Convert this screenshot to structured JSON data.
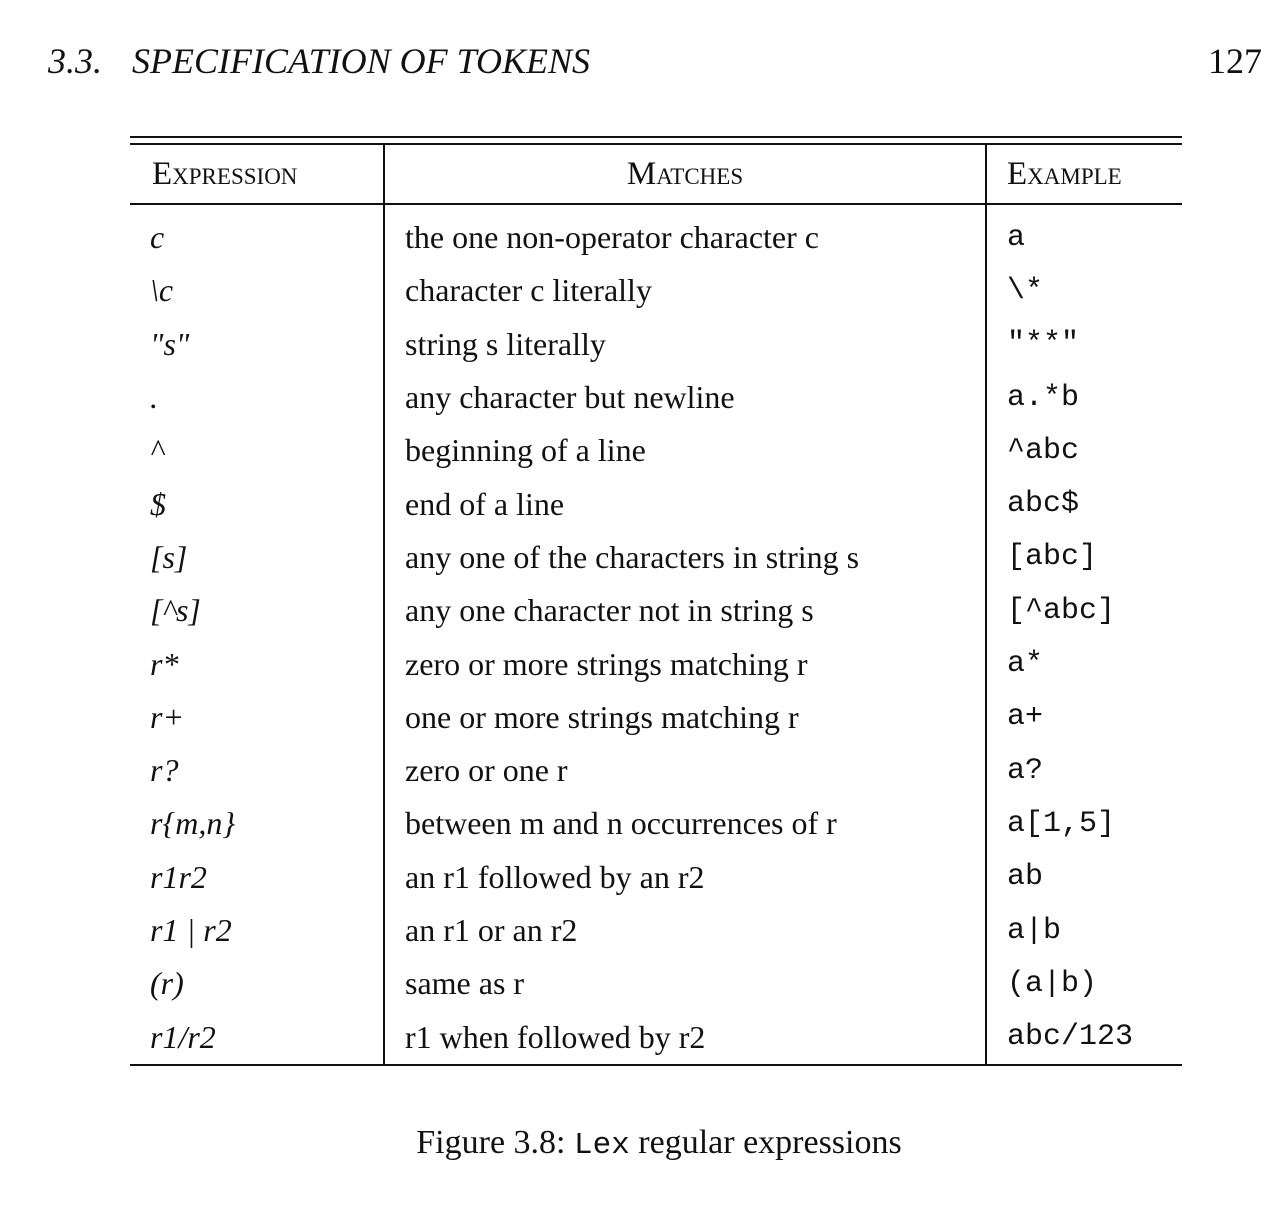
{
  "running_head": {
    "section_number": "3.3.",
    "section_title": "SPECIFICATION OF TOKENS",
    "page_number": "127"
  },
  "table": {
    "headers": [
      "Expression",
      "Matches",
      "Example"
    ],
    "rows": [
      {
        "expression": "c",
        "matches": "the one non-operator character c",
        "example": "a"
      },
      {
        "expression": "\\c",
        "matches": "character c literally",
        "example": "\\*"
      },
      {
        "expression": "\"s\"",
        "matches": "string s literally",
        "example": "\"**\""
      },
      {
        "expression": ".",
        "matches": "any character but newline",
        "example": "a.*b"
      },
      {
        "expression": "^",
        "matches": "beginning of a line",
        "example": "^abc"
      },
      {
        "expression": "$",
        "matches": "end of a line",
        "example": "abc$"
      },
      {
        "expression": "[s]",
        "matches": "any one of the characters in string s",
        "example": "[abc]"
      },
      {
        "expression": "[^s]",
        "matches": "any one character not in string s",
        "example": "[^abc]"
      },
      {
        "expression": "r*",
        "matches": "zero or more strings matching r",
        "example": "a*"
      },
      {
        "expression": "r+",
        "matches": "one or more strings matching r",
        "example": "a+"
      },
      {
        "expression": "r?",
        "matches": "zero or one r",
        "example": "a?"
      },
      {
        "expression": "r{m,n}",
        "matches": "between m and n occurrences of r",
        "example": "a[1,5]"
      },
      {
        "expression": "r1r2",
        "matches": "an r1 followed by an r2",
        "example": "ab"
      },
      {
        "expression": "r1 | r2",
        "matches": "an r1 or an r2",
        "example": "a|b"
      },
      {
        "expression": "(r)",
        "matches": "same as r",
        "example": "(a|b)"
      },
      {
        "expression": "r1/r2",
        "matches": "r1 when followed by r2",
        "example": "abc/123"
      }
    ]
  },
  "caption": {
    "prefix": "Figure 3.8:",
    "mono_word": "Lex",
    "rest": "regular expressions"
  }
}
